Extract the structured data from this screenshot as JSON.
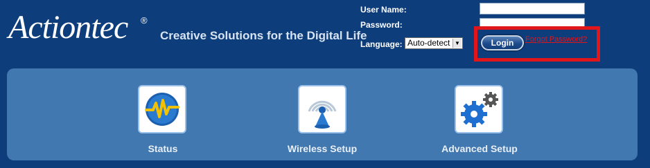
{
  "brand": {
    "logo_text": "Actiontec",
    "registered_mark": "®",
    "tagline": "Creative Solutions for the Digital Life"
  },
  "login": {
    "username_label": "User Name:",
    "username_value": "",
    "password_label": "Password:",
    "password_value": "",
    "language_label": "Language:",
    "language_selected": "Auto-detect",
    "login_button": "Login",
    "forgot_link": "Forgot Password?"
  },
  "nav": {
    "items": [
      {
        "label": "Status",
        "icon": "status-icon"
      },
      {
        "label": "Wireless Setup",
        "icon": "wireless-icon"
      },
      {
        "label": "Advanced Setup",
        "icon": "gears-icon"
      }
    ]
  },
  "colors": {
    "header_bg": "#0e3d7c",
    "panel_bg": "#4178b0",
    "highlight": "#e0161b"
  }
}
